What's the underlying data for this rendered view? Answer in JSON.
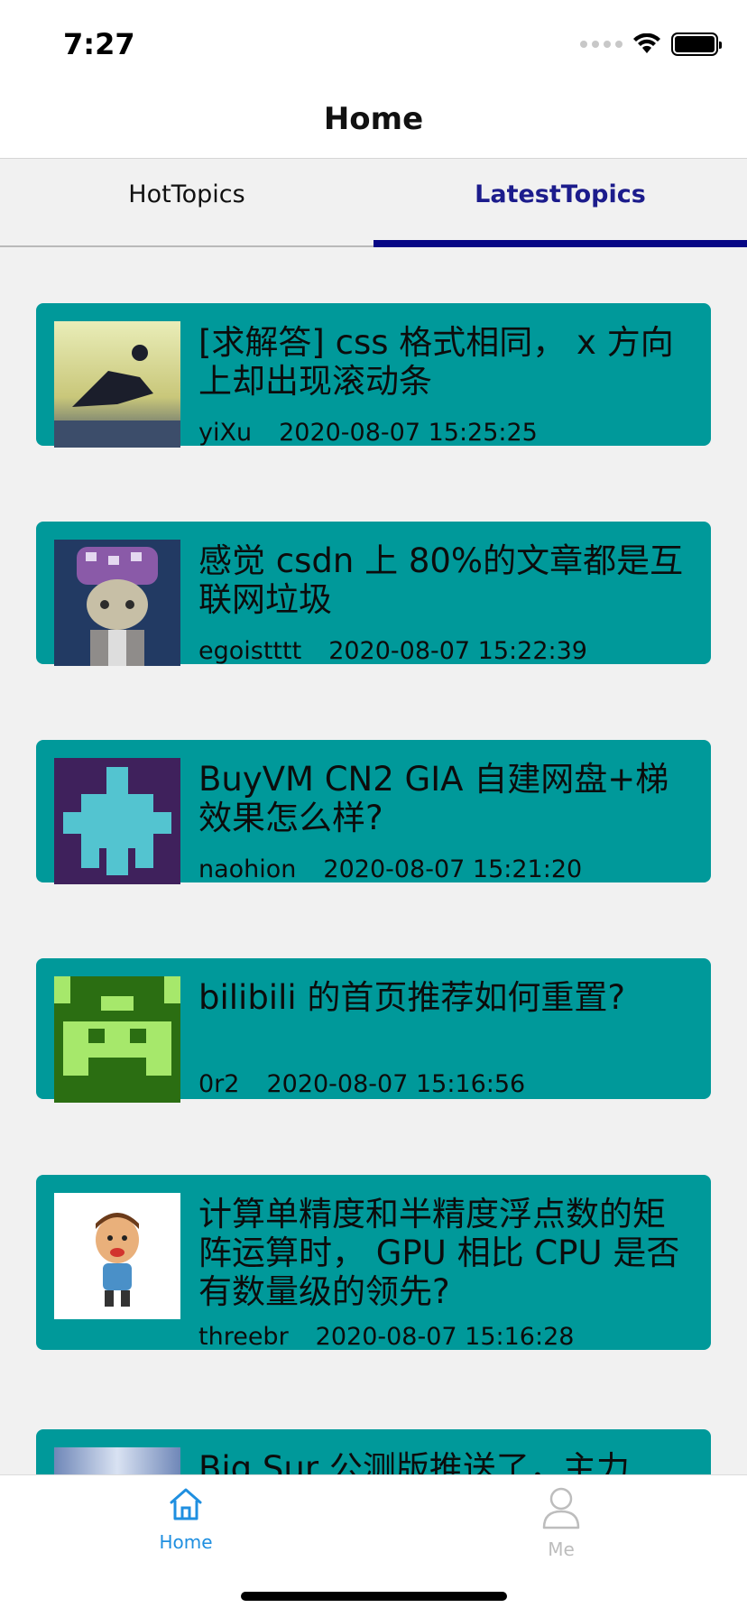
{
  "status_bar": {
    "time": "7:27"
  },
  "header": {
    "title": "Home"
  },
  "tabs": [
    {
      "label": "HotTopics",
      "active": false
    },
    {
      "label": "LatestTopics",
      "active": true
    }
  ],
  "topics": [
    {
      "title": "[求解答] css 格式相同， x 方向上却出现滚动条",
      "author": "yiXu",
      "time": "2020-08-07 15:25:25"
    },
    {
      "title": "感觉 csdn 上 80%的文章都是互联网垃圾",
      "author": "egoistttt",
      "time": "2020-08-07 15:22:39"
    },
    {
      "title": "BuyVM CN2 GIA 自建网盘+梯效果怎么样?",
      "author": "naohion",
      "time": "2020-08-07 15:21:20"
    },
    {
      "title": "bilibili 的首页推荐如何重置?",
      "author": "0r2",
      "time": "2020-08-07 15:16:56"
    },
    {
      "title": "计算单精度和半精度浮点数的矩阵运算时， GPU 相比 CPU 是否有数量级的领先?",
      "author": "threebr",
      "time": "2020-08-07 15:16:28"
    },
    {
      "title": "Big Sur 公测版推送了，主力",
      "author": "",
      "time": ""
    }
  ],
  "bottom_nav": {
    "home_label": "Home",
    "me_label": "Me"
  },
  "colors": {
    "card": "#00999a",
    "active_tab": "#070785",
    "home_active": "#1f8fe0",
    "me_inactive": "#bdbdbd"
  }
}
